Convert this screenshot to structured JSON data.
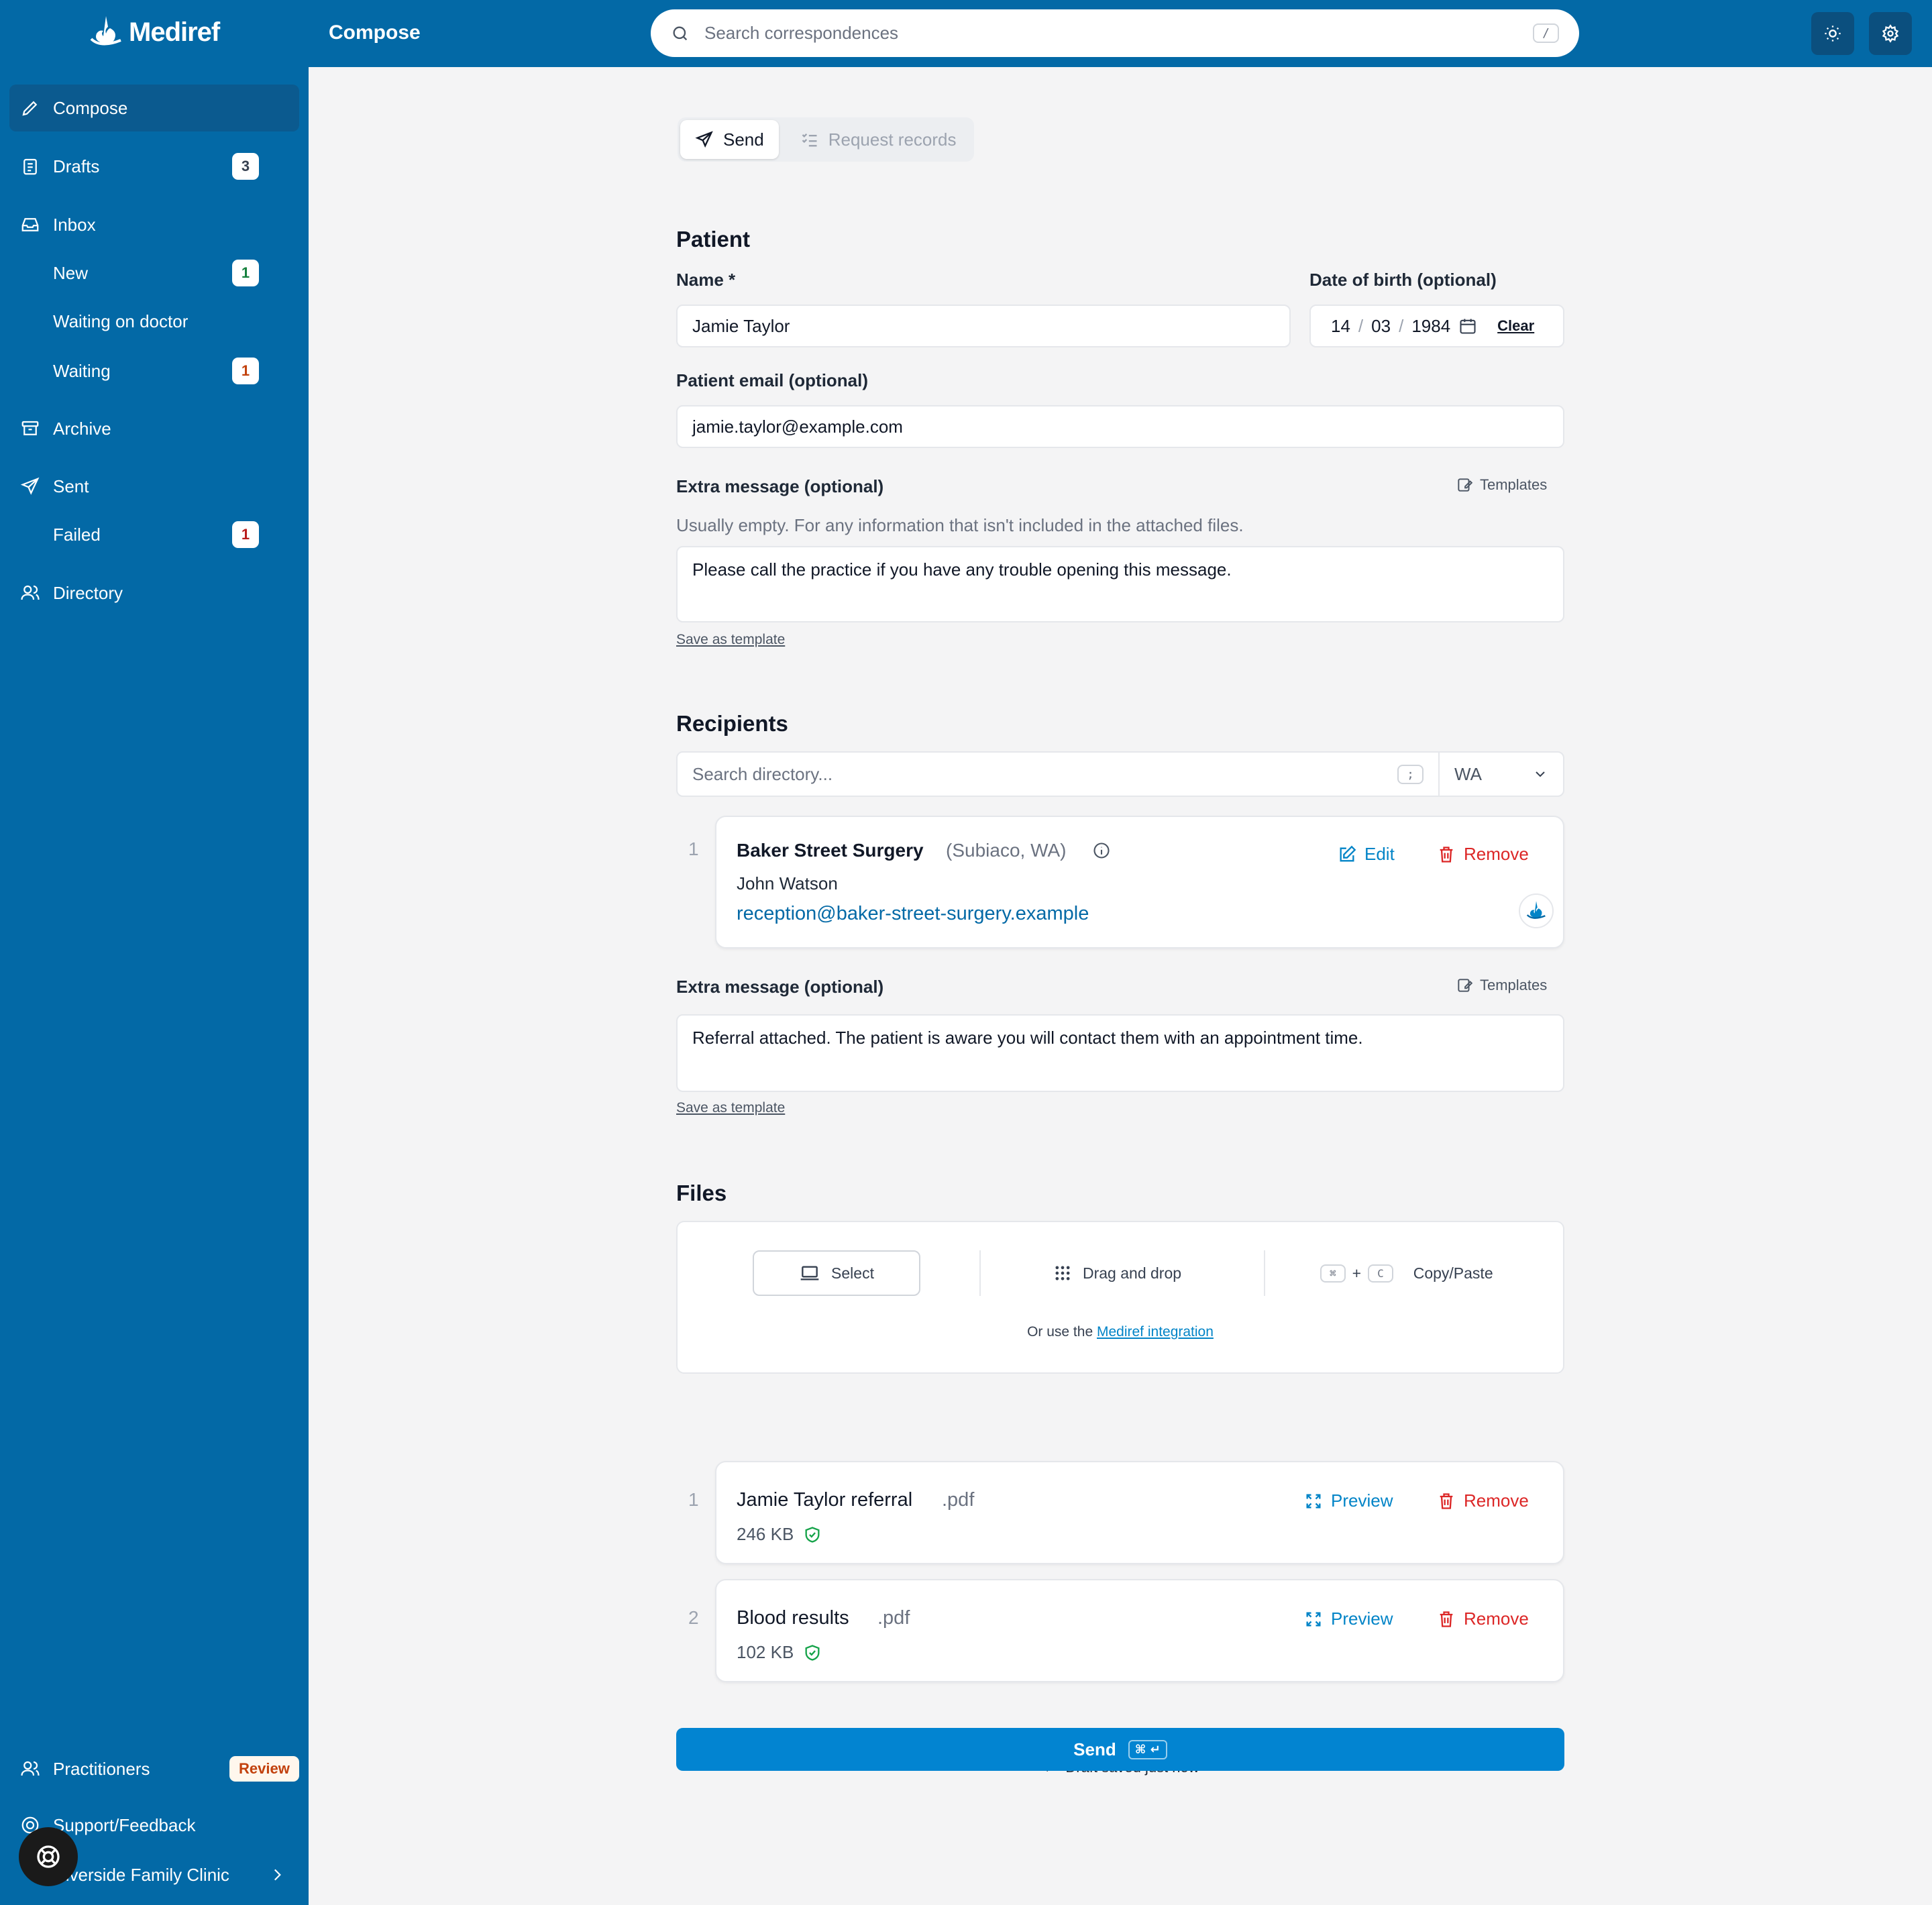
{
  "app": {
    "brand": "Mediref",
    "page_title": "Compose"
  },
  "search": {
    "placeholder": "Search correspondences",
    "shortcut": "/"
  },
  "sidebar": {
    "items": [
      {
        "label": "Compose"
      },
      {
        "label": "Drafts",
        "badge": "3"
      },
      {
        "label": "Inbox"
      },
      {
        "label": "New",
        "badge": "1"
      },
      {
        "label": "Waiting on doctor"
      },
      {
        "label": "Waiting",
        "badge": "1"
      },
      {
        "label": "Archive"
      },
      {
        "label": "Sent"
      },
      {
        "label": "Failed",
        "badge": "1"
      },
      {
        "label": "Directory"
      }
    ],
    "bottom": {
      "practitioners": "Practitioners",
      "review": "Review",
      "support": "Support/Feedback",
      "clinic": "Riverside Family Clinic"
    }
  },
  "mode": {
    "send": "Send",
    "request": "Request records"
  },
  "patient": {
    "heading": "Patient",
    "name_label": "Name *",
    "name_value": "Jamie Taylor",
    "dob_label": "Date of birth (optional)",
    "dob_day": "14",
    "dob_month": "03",
    "dob_year": "1984",
    "dob_sep": "/",
    "clear": "Clear",
    "email_label": "Patient email (optional)",
    "email_value": "jamie.taylor@example.com",
    "extra_label": "Extra message (optional)",
    "extra_hint": "Usually empty. For any information that isn't included in the attached files.",
    "extra_value": "Please call the practice if you have any trouble opening this message.",
    "templates": "Templates",
    "save_template": "Save as template"
  },
  "recipients": {
    "heading": "Recipients",
    "search_placeholder": "Search directory...",
    "search_shortcut": ";",
    "state": "WA",
    "list": [
      {
        "index": "1",
        "name": "Baker Street Surgery",
        "location": "(Subiaco, WA)",
        "contact": "John Watson",
        "email": "reception@baker-street-surgery.example",
        "edit": "Edit",
        "remove": "Remove"
      }
    ],
    "extra_label": "Extra message (optional)",
    "extra_value": "Referral attached. The patient is aware you will contact them with an appointment time.",
    "templates": "Templates",
    "save_template": "Save as template"
  },
  "files": {
    "heading": "Files",
    "select": "Select",
    "drag": "Drag and drop",
    "key_cmd": "⌘",
    "key_plus": "+",
    "key_c": "C",
    "copy": "Copy/Paste",
    "or_use": "Or use the",
    "integration": "Mediref integration",
    "list": [
      {
        "index": "1",
        "name": "Jamie Taylor referral",
        "ext": ".pdf",
        "size": "246 KB",
        "preview": "Preview",
        "remove": "Remove"
      },
      {
        "index": "2",
        "name": "Blood results",
        "ext": ".pdf",
        "size": "102 KB",
        "preview": "Preview",
        "remove": "Remove"
      }
    ]
  },
  "footer": {
    "draft_status": "Draft saved just now",
    "send": "Send",
    "send_shortcut": "⌘ ↵"
  },
  "colors": {
    "brand_blue": "#0369a6",
    "primary_button": "#0284d1",
    "danger": "#dc2626",
    "success": "#16a34a"
  },
  "icons": {
    "logo": "mediref-logo-icon",
    "search": "search-icon",
    "theme": "sun-icon",
    "settings": "gear-icon"
  }
}
